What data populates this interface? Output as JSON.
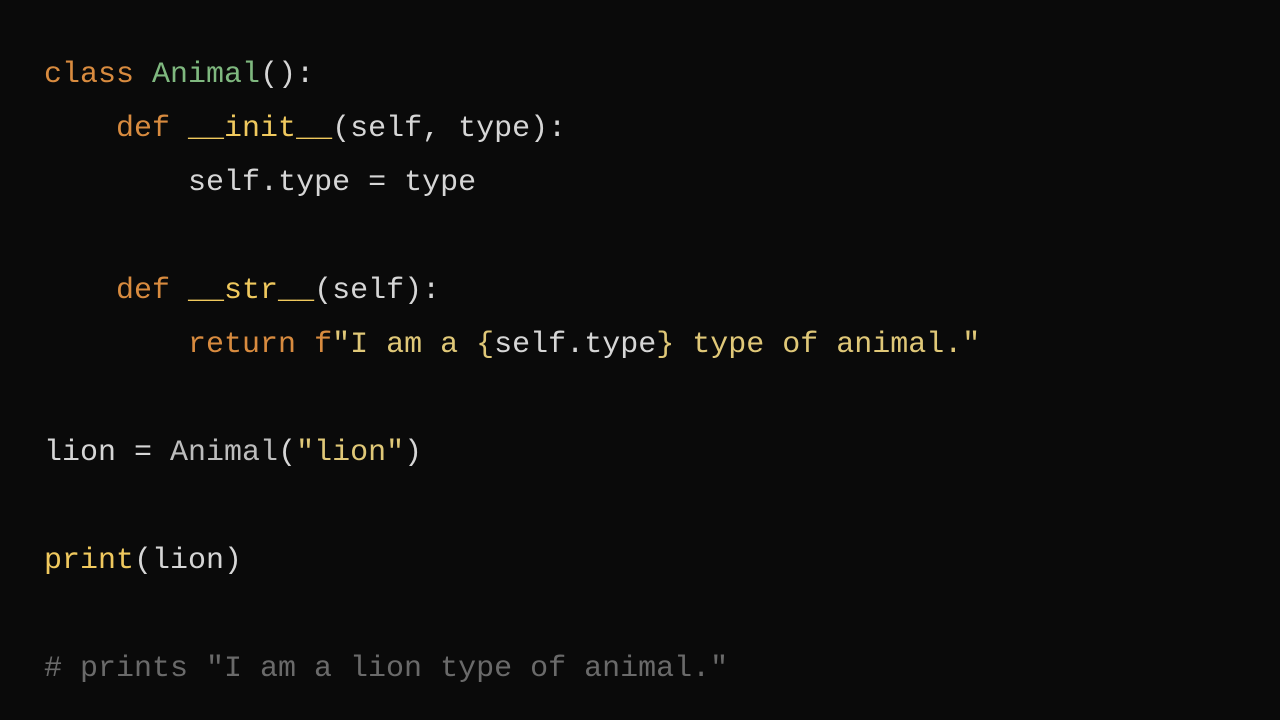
{
  "code": {
    "l1_class": "class",
    "l1_space1": " ",
    "l1_name": "Animal",
    "l1_paren": "()",
    "l1_colon": ":",
    "l2_indent": "    ",
    "l2_def": "def",
    "l2_space": " ",
    "l2_fn": "__init__",
    "l2_open": "(",
    "l2_self": "self",
    "l2_comma": ", ",
    "l2_type": "type",
    "l2_close": ")",
    "l2_colon": ":",
    "l3_indent": "        ",
    "l3_self": "self",
    "l3_dot": ".",
    "l3_attr": "type",
    "l3_eq": " = ",
    "l3_rhs": "type",
    "l5_indent": "    ",
    "l5_def": "def",
    "l5_space": " ",
    "l5_fn": "__str__",
    "l5_open": "(",
    "l5_self": "self",
    "l5_close": ")",
    "l5_colon": ":",
    "l6_indent": "        ",
    "l6_return": "return",
    "l6_space": " ",
    "l6_f": "f",
    "l6_q1": "\"",
    "l6_s1": "I am a ",
    "l6_b1": "{",
    "l6_self": "self",
    "l6_dot": ".",
    "l6_type": "type",
    "l6_b2": "}",
    "l6_s2": " type of animal.",
    "l6_q2": "\"",
    "l8_var": "lion",
    "l8_eq": " = ",
    "l8_cls": "Animal",
    "l8_open": "(",
    "l8_str": "\"lion\"",
    "l8_close": ")",
    "l10_print": "print",
    "l10_open": "(",
    "l10_arg": "lion",
    "l10_close": ")",
    "l12_comment": "# prints \"I am a lion type of animal.\""
  }
}
